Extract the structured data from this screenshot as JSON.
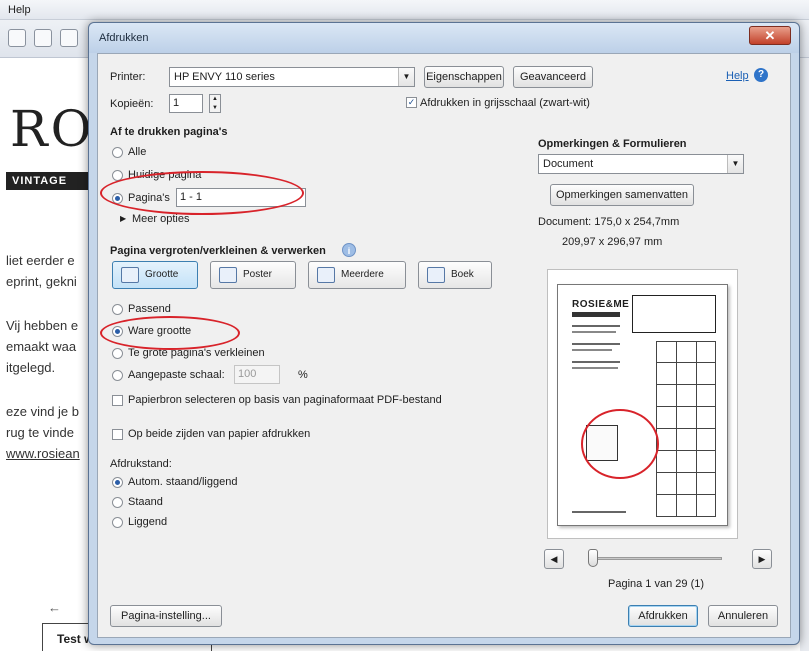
{
  "background_app": {
    "menu_help": "Help",
    "logo": "ROS",
    "tagline": "VINTAGE",
    "lines": [
      "liet eerder e",
      "eprint, gekni",
      "Vij hebben e",
      "emaakt waa",
      "itgelegd.",
      "eze vind je b",
      "rug te vinde",
      "www.rosiean"
    ],
    "bottom_box": "Test werkart"
  },
  "dialog": {
    "title": "Afdrukken",
    "close_glyph": "✕",
    "printer": {
      "label": "Printer:",
      "value": "HP ENVY 110 series",
      "properties_button": "Eigenschappen",
      "advanced_button": "Geavanceerd"
    },
    "help_link": "Help",
    "copies": {
      "label": "Kopieën:",
      "value": "1"
    },
    "grayscale": {
      "label": "Afdrukken in grijsschaal (zwart-wit)",
      "checked": true
    },
    "pages_section": {
      "heading": "Af te drukken pagina's",
      "all": "Alle",
      "current": "Huidige pagina",
      "pages": "Pagina's",
      "pages_value": "1 - 1",
      "more_options": "Meer opties"
    },
    "scaling_section": {
      "heading": "Pagina vergroten/verkleinen & verwerken",
      "modes": [
        "Grootte",
        "Poster",
        "Meerdere",
        "Boek"
      ],
      "fit": "Passend",
      "actual_size": "Ware grootte",
      "shrink": "Te grote pagina's verkleinen",
      "custom": "Aangepaste schaal:",
      "custom_value": "100",
      "percent": "%",
      "paper_source": "Papierbron selecteren op basis van paginaformaat PDF-bestand"
    },
    "duplex": "Op beide zijden van papier afdrukken",
    "orientation": {
      "heading": "Afdrukstand:",
      "auto": "Autom. staand/liggend",
      "portrait": "Staand",
      "landscape": "Liggend"
    },
    "comments_section": {
      "heading": "Opmerkingen & Formulieren",
      "value": "Document",
      "summarize_button": "Opmerkingen samenvatten"
    },
    "document_size": "Document: 175,0 x 254,7mm",
    "paper_size": "209,97 x 296,97 mm",
    "preview": {
      "logo": "ROSIE&ME",
      "page_info": "Pagina 1 van 29 (1)"
    },
    "page_setup_button": "Pagina-instelling...",
    "print_button": "Afdrukken",
    "cancel_button": "Annuleren"
  },
  "colors": {
    "annotation": "#d8232a",
    "dialog_frame": "#c5d6ea",
    "link": "#1a5fb4"
  }
}
